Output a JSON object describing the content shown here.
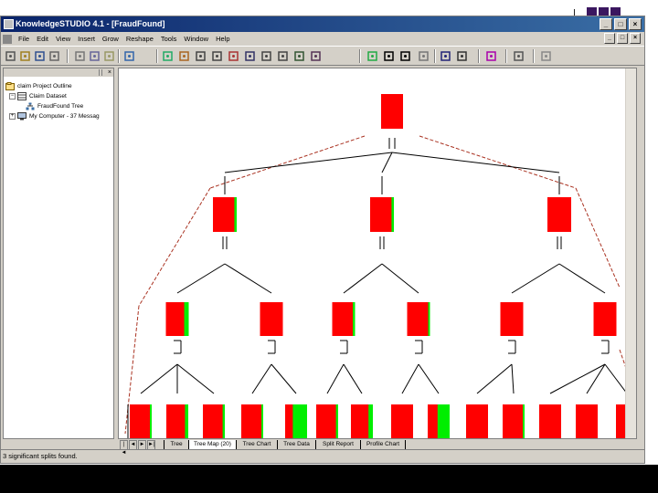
{
  "window": {
    "title": "KnowledgeSTUDIO 4.1 - [FraudFound]",
    "buttons": {
      "minimize": "_",
      "maximize": "□",
      "close": "×"
    }
  },
  "menu": [
    "File",
    "Edit",
    "View",
    "Insert",
    "Grow",
    "Reshape",
    "Tools",
    "Window",
    "Help"
  ],
  "toolbar": {
    "icons": [
      "new-icon",
      "open-icon",
      "save-icon",
      "print-icon",
      "cut-icon",
      "copy-icon",
      "paste-icon",
      "help-icon",
      "grow-icon",
      "find-split-icon",
      "grow-level-icon",
      "grow-all-icon",
      "prune-icon",
      "force-icon",
      "copy-split-icon",
      "paste-split-icon",
      "expand-icon",
      "collapse-icon",
      "tree-icon",
      "node-icon",
      "report-icon",
      "chart-icon",
      "chart-alt-icon",
      "person-icon",
      "target-icon",
      "view-icon",
      "flag-icon"
    ]
  },
  "outline": {
    "close": "×",
    "items": [
      {
        "label": "claim Project Outline",
        "expander": "",
        "icon": "project-icon"
      },
      {
        "label": "Claim Dataset",
        "expander": "−",
        "icon": "dataset-icon"
      },
      {
        "label": "FraudFound Tree",
        "expander": "",
        "icon": "tree-icon"
      },
      {
        "label": "My Computer - 37 Messag",
        "expander": "+",
        "icon": "computer-icon"
      }
    ]
  },
  "tabs": [
    "Tree",
    "Tree Map (20)",
    "Tree Chart",
    "Tree Data",
    "Split Report",
    "Profile Chart"
  ],
  "active_tab": 1,
  "tab_nav": [
    "|◄",
    "◄",
    "►",
    "►|"
  ],
  "status": "3 significant splits found.",
  "colors": {
    "node_red": "#ff0000",
    "node_green": "#00ee00",
    "connector": "#000000",
    "title_bar": "#0a246a"
  },
  "tree_map": {
    "root": {
      "green_fraction": 0
    },
    "level1": [
      {
        "green_fraction": 0.1
      },
      {
        "green_fraction": 0.1
      },
      {
        "green_fraction": 0
      }
    ],
    "level2": [
      {
        "green_fraction": 0.2
      },
      {
        "green_fraction": 0
      },
      {
        "green_fraction": 0.1
      },
      {
        "green_fraction": 0.05
      },
      {
        "green_fraction": 0
      },
      {
        "green_fraction": 0
      }
    ],
    "level3": [
      {
        "green_fraction": 0.05
      },
      {
        "green_fraction": 0.15
      },
      {
        "green_fraction": 0.1
      },
      {
        "green_fraction": 0.05
      },
      {
        "green_fraction": 0.65
      },
      {
        "green_fraction": 0.1
      },
      {
        "green_fraction": 0.2
      },
      {
        "green_fraction": 0
      },
      {
        "green_fraction": 0.55
      },
      {
        "green_fraction": 0
      },
      {
        "green_fraction": 0.05
      },
      {
        "green_fraction": 0
      },
      {
        "green_fraction": 0
      },
      {
        "green_fraction": 0
      }
    ]
  }
}
